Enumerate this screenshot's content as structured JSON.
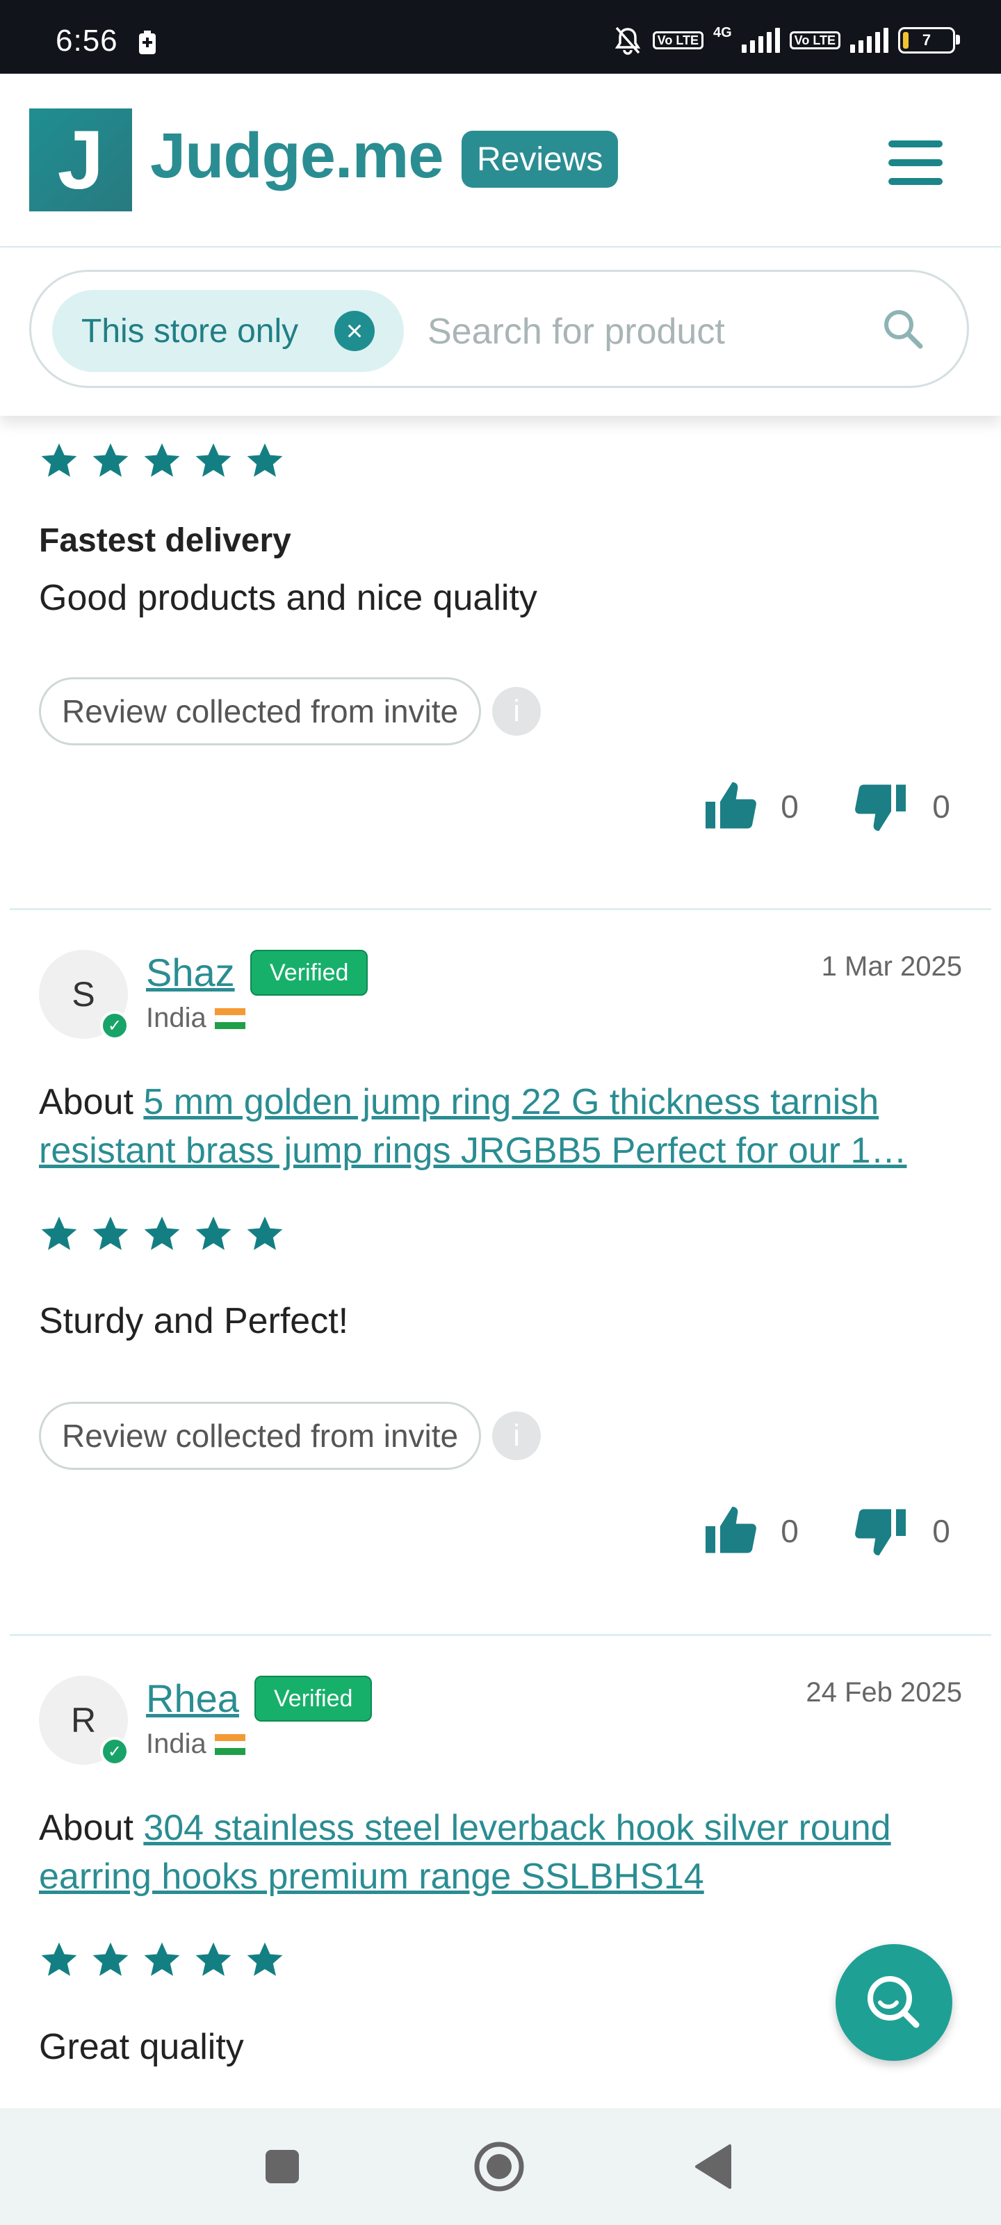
{
  "status_bar": {
    "time": "6:56",
    "network": "4G",
    "volte1": "Vo LTE",
    "volte2": "Vo LTE",
    "battery": "7"
  },
  "header": {
    "logo_letter": "J",
    "brand": "Judge.me",
    "pill": "Reviews"
  },
  "search": {
    "chip_label": "This store only",
    "placeholder": "Search for product"
  },
  "reviews": [
    {
      "stars": 5,
      "title": "Fastest delivery",
      "body": "Good products and nice quality",
      "source": "Review collected from invite",
      "info": "i",
      "likes": "0",
      "dislikes": "0"
    },
    {
      "avatar": "S",
      "name": "Shaz",
      "verified": "Verified",
      "country": "India",
      "date": "1 Mar 2025",
      "about_prefix": "About",
      "product": "5 mm golden jump ring 22 G thickness tarnish resistant brass jump rings JRGBB5 Perfect for our 1…",
      "stars": 5,
      "body": "Sturdy and Perfect!",
      "source": "Review collected from invite",
      "info": "i",
      "likes": "0",
      "dislikes": "0"
    },
    {
      "avatar": "R",
      "name": "Rhea",
      "verified": "Verified",
      "country": "India",
      "date": "24 Feb 2025",
      "about_prefix": "About",
      "product": "304 stainless steel leverback hook silver round earring hooks premium range SSLBHS14",
      "stars": 5,
      "body": "Great quality"
    }
  ],
  "colors": {
    "brand": "#2a8d92",
    "star": "#147f83",
    "verified": "#17b06b",
    "fab": "#1fa095"
  }
}
